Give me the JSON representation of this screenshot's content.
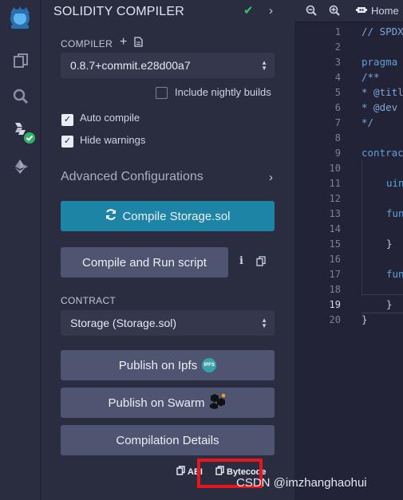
{
  "sidebar_icons": [
    "remix-logo-icon",
    "file-explorer-icon",
    "search-icon",
    "solidity-compiler-icon",
    "deploy-run-icon"
  ],
  "panel": {
    "title": "SOLIDITY COMPILER",
    "compiler_label": "COMPILER",
    "compiler_version": "0.8.7+commit.e28d00a7",
    "include_nightly": "Include nightly builds",
    "auto_compile": "Auto compile",
    "hide_warnings": "Hide warnings",
    "advanced": "Advanced Configurations",
    "compile_button": "Compile Storage.sol",
    "compile_run_button": "Compile and Run script",
    "contract_label": "CONTRACT",
    "contract_value": "Storage (Storage.sol)",
    "publish_ipfs": "Publish on Ipfs",
    "ipfs_badge": "IPFS",
    "publish_swarm": "Publish on Swarm",
    "compilation_details": "Compilation Details",
    "abi": "ABI",
    "bytecode": "Bytecode"
  },
  "editor": {
    "home_tab": "Home",
    "line_numbers": [
      "1",
      "2",
      "3",
      "4",
      "5",
      "6",
      "7",
      "8",
      "9",
      "10",
      "11",
      "12",
      "13",
      "14",
      "15",
      "16",
      "17",
      "18",
      "19",
      "20"
    ],
    "current_line": "19",
    "lines": {
      "l1": "// SPDX",
      "l3": "pragma",
      "l4": "/**",
      "l5": "* @titl",
      "l6": "* @dev",
      "l7": "*/",
      "l9": "contrac",
      "l11": "uin",
      "l13": "fun",
      "l15": "}",
      "l17": "fun",
      "l19": "}",
      "l20": "}"
    }
  },
  "watermark": "CSDN @imzhanghaohui",
  "colors": {
    "compile_primary": "#1e84a6",
    "success_check": "#2fc870",
    "highlight_box": "#e8161b"
  }
}
